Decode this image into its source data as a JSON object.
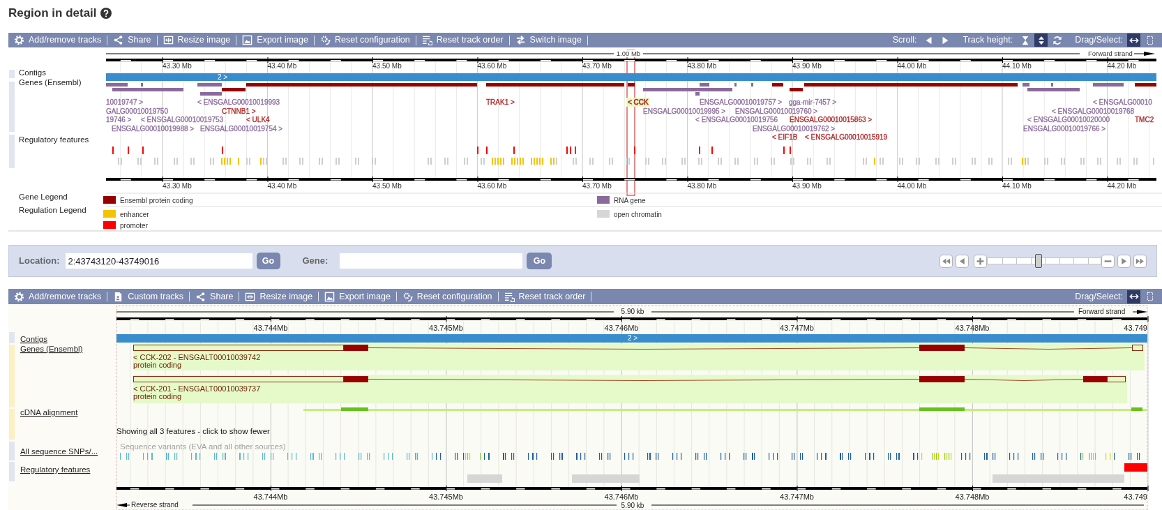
{
  "title": "Region in detail",
  "overview_panel": {
    "toolbar": {
      "buttons": [
        "Add/remove tracks",
        "Share",
        "Resize image",
        "Export image",
        "Reset configuration",
        "Reset track order",
        "Switch image"
      ],
      "scroll_label": "Scroll:",
      "track_height_label": "Track height:",
      "track_height_modes": [
        {
          "selected": false
        },
        {
          "selected": true
        }
      ],
      "drag_select_label": "Drag/Select:",
      "drag_modes": [
        {
          "selected": true
        },
        {
          "selected": false
        }
      ]
    },
    "span_label": "1.00 Mb",
    "strand_label": "Forward strand",
    "axis_ticks": [
      "43.30 Mb",
      "43.40 Mb",
      "43.50 Mb",
      "43.60 Mb",
      "43.70 Mb",
      "43.80 Mb",
      "43.90 Mb",
      "44.00 Mb",
      "44.10 Mb",
      "44.20 Mb"
    ],
    "contig_label": "2 >",
    "tracks": [
      "Contigs",
      "Genes (Ensembl)",
      "Regulatory features"
    ],
    "gene_labels": [
      [
        {
          "text": "10019747 >",
          "color": "#8e6e9e",
          "selected": false
        },
        {
          "text": "< ENSGALG00010019993",
          "color": "#8e6e9e",
          "selected": false
        },
        {
          "text": "TRAK1 >",
          "color": "#b02a2a",
          "selected": false
        },
        {
          "text": "< CCK",
          "color": "#b02a2a",
          "selected": true
        },
        {
          "text": "ENSGALG00010019757 >",
          "color": "#8e6e9e",
          "selected": false
        },
        {
          "text": "gga-mir-7457 >",
          "color": "#8e6e9e",
          "selected": false
        },
        {
          "text": "< ENSGALG00010",
          "color": "#8e6e9e",
          "selected": false
        }
      ],
      [
        {
          "text": "GALG00010019750",
          "color": "#8e6e9e",
          "selected": false
        },
        {
          "text": "CTNNB1 >",
          "color": "#b02a2a",
          "selected": false
        },
        {
          "text": "ENSGALG00010019995 >",
          "color": "#8e6e9e",
          "selected": false
        },
        {
          "text": "ENSGALG00010019760 >",
          "color": "#8e6e9e",
          "selected": false
        },
        {
          "text": "< ENSGALG00010019768",
          "color": "#8e6e9e",
          "selected": false
        }
      ],
      [
        {
          "text": "19746 >",
          "color": "#8e6e9e",
          "selected": false
        },
        {
          "text": "< ENSGALG00010019753",
          "color": "#8e6e9e",
          "selected": false
        },
        {
          "text": "< ULK4",
          "color": "#b02a2a",
          "selected": false
        },
        {
          "text": "< ENSGALG00010019756",
          "color": "#8e6e9e",
          "selected": false
        },
        {
          "text": "ENSGALG00010015863 >",
          "color": "#b02a2a",
          "selected": false
        },
        {
          "text": "< ENSGALG00010020000",
          "color": "#8e6e9e",
          "selected": false
        },
        {
          "text": "TMC2",
          "color": "#b02a2a",
          "selected": false
        }
      ],
      [
        {
          "text": "ENSGALG00010019988 >",
          "color": "#8e6e9e",
          "selected": false
        },
        {
          "text": "ENSGALG00010019754 >",
          "color": "#8e6e9e",
          "selected": false
        },
        {
          "text": "ENSGALG00010019762 >",
          "color": "#8e6e9e",
          "selected": false
        },
        {
          "text": "ENSGALG00010019766 >",
          "color": "#8e6e9e",
          "selected": false
        }
      ],
      [
        {
          "text": "< EIF1B",
          "color": "#b02a2a",
          "selected": false
        },
        {
          "text": "< ENSGALG00010015919",
          "color": "#b02a2a",
          "selected": false
        }
      ]
    ],
    "bottom_axis_ticks": [
      "43.30 Mb",
      "43.40 Mb",
      "43.50 Mb",
      "43.60 Mb",
      "43.70 Mb",
      "43.80 Mb",
      "43.90 Mb",
      "44.00 Mb",
      "44.10 Mb",
      "44.20 Mb"
    ],
    "legends": [
      {
        "label": "Gene Legend",
        "items": [
          {
            "text": "Ensembl protein coding",
            "color": "#990000"
          },
          {
            "text": "RNA gene",
            "color": "#8b6a9b"
          }
        ]
      },
      {
        "label": "Regulation Legend",
        "items": [
          {
            "text": "enhancer",
            "color": "#f5c400"
          },
          {
            "text": "open chromatin",
            "color": "#d6d6d6"
          },
          {
            "text": "promoter",
            "color": "#ff0000"
          }
        ]
      }
    ]
  },
  "navigation": {
    "location_label": "Location:",
    "location_value": "2:43743120-43749016",
    "location_button": "Go",
    "gene_label": "Gene:",
    "gene_button": "Go",
    "zoom": {
      "level": 0.45
    }
  },
  "detail_panel": {
    "toolbar": {
      "buttons": [
        "Add/remove tracks",
        "Custom tracks",
        "Share",
        "Resize image",
        "Export image",
        "Reset configuration",
        "Reset track order"
      ],
      "drag_select_label": "Drag/Select:",
      "drag_modes": [
        {
          "selected": true
        },
        {
          "selected": false
        }
      ]
    },
    "span_label": "5.90 kb",
    "strand_label": "Forward strand",
    "axis_ticks": [
      "43.744Mb",
      "43.745Mb",
      "43.746Mb",
      "43.747Mb",
      "43.748Mb",
      "43.749"
    ],
    "contig_label": "2 >",
    "tracks": [
      "Contigs",
      "Genes (Ensembl)",
      "cDNA alignment",
      "All sequence SNPs/...",
      "Regulatory features"
    ],
    "transcripts": [
      {
        "name": "< CCK-202 - ENSGALT00010039742",
        "biotype": "protein coding"
      },
      {
        "name": "< CCK-201 - ENSGALT00010039737",
        "biotype": "protein coding"
      }
    ],
    "feature_note": "Showing all 3 features - click to show fewer",
    "variant_source": "Sequence variants (EVA and all other sources)",
    "bottom_axis_ticks": [
      "43.744Mb",
      "43.745Mb",
      "43.746Mb",
      "43.747Mb",
      "43.748Mb",
      "43.749"
    ],
    "reverse_strand_label": "Reverse strand",
    "bottom_span_label": "5.90 kb"
  }
}
